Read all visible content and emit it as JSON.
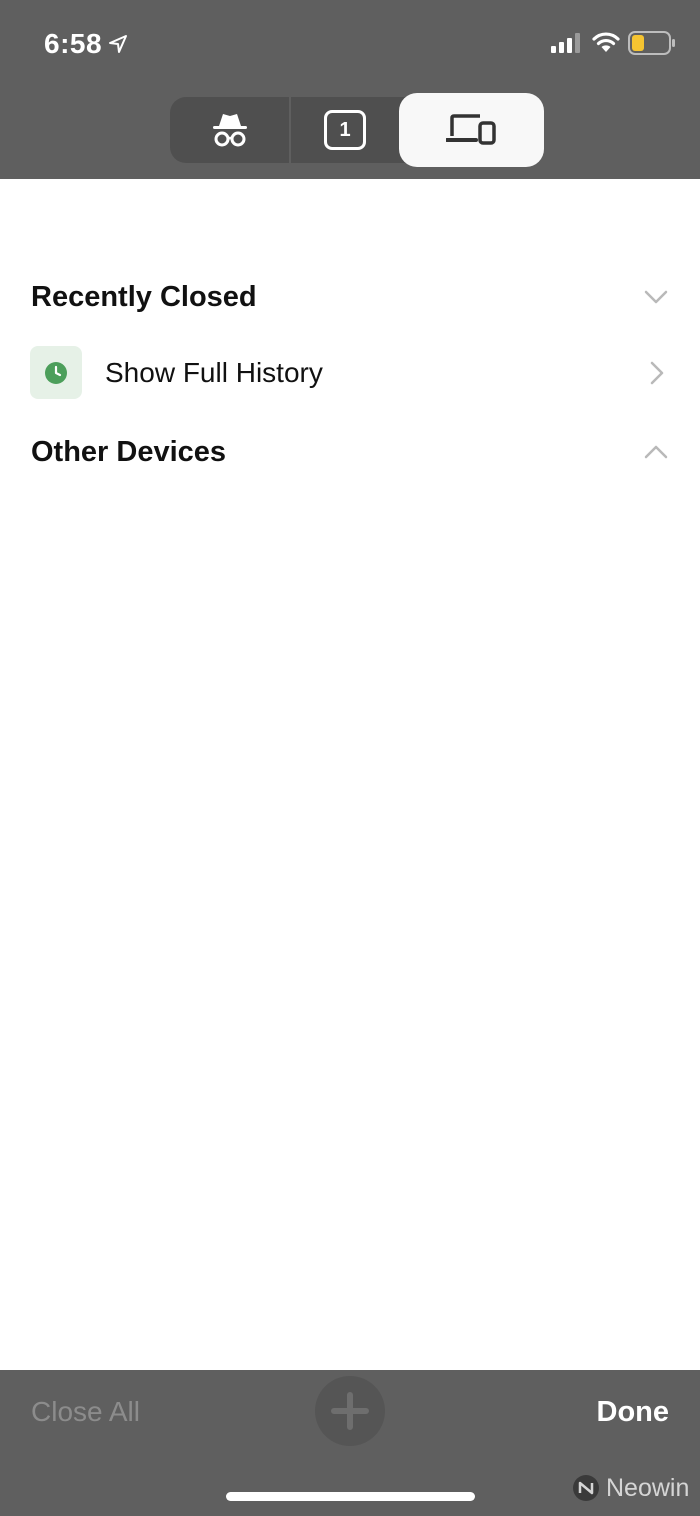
{
  "status_bar": {
    "time": "6:58",
    "icons": [
      "location-arrow-icon",
      "cellular-signal-icon",
      "wifi-icon",
      "battery-low-icon"
    ],
    "battery_color": "#f5c431"
  },
  "tab_switcher": {
    "segments": [
      {
        "name": "incognito-tabs",
        "icon": "incognito-icon"
      },
      {
        "name": "open-tabs",
        "count": "1"
      },
      {
        "name": "other-devices",
        "icon": "devices-icon",
        "selected": true
      }
    ]
  },
  "content": {
    "recently_closed_title": "Recently Closed",
    "show_full_history_label": "Show Full History",
    "other_devices_title": "Other Devices",
    "history_icon_color": "#4c9f5b"
  },
  "toolbar": {
    "close_all_label": "Close All",
    "done_label": "Done"
  },
  "watermark": {
    "text": "Neowin"
  }
}
